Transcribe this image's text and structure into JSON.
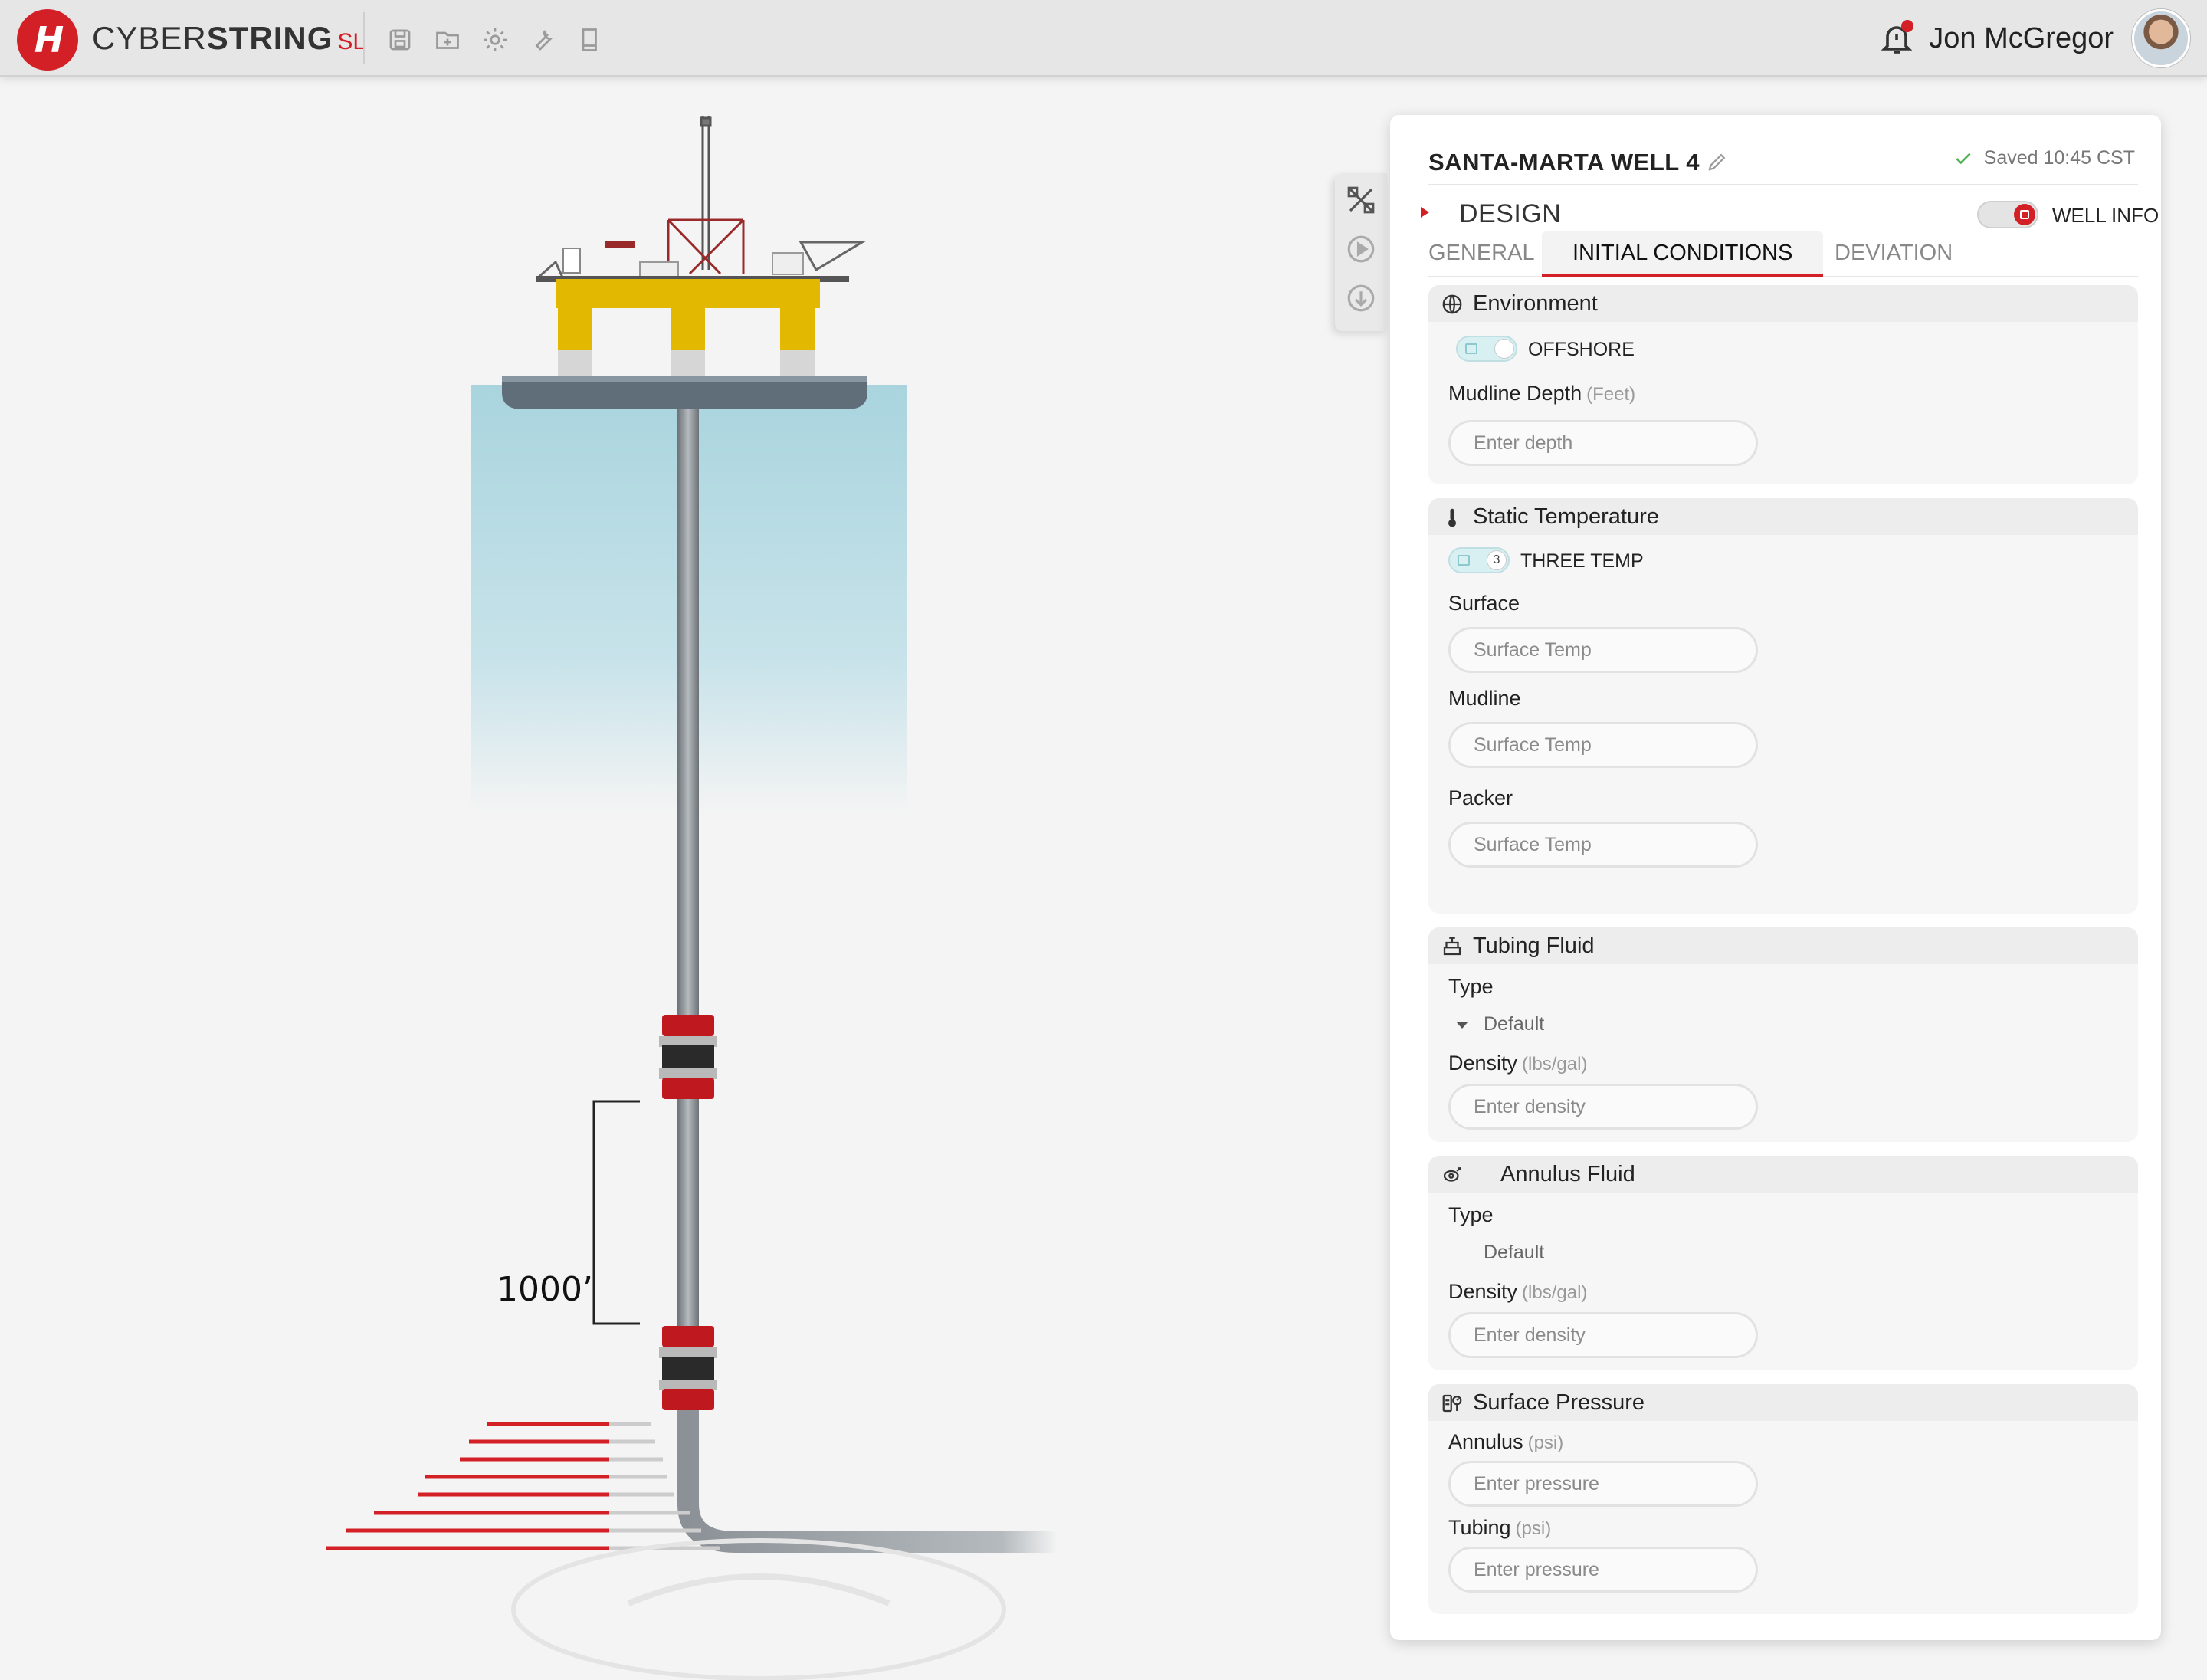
{
  "app": {
    "logo_letter": "H",
    "brand_light": "CYBER",
    "brand_bold": "STRING",
    "brand_suffix": "SL",
    "toolbar_icons": [
      "save-icon",
      "folder-add-icon",
      "settings-icon",
      "wrench-icon",
      "book-icon"
    ]
  },
  "user": {
    "name": "Jon McGregor",
    "has_notification": true
  },
  "illustration": {
    "depth_label": "1000’"
  },
  "rail": {
    "icons": [
      "design-tools-icon",
      "play-icon",
      "download-icon"
    ]
  },
  "panel": {
    "well_name": "SANTA-MARTA WELL 4",
    "saved_status": "Saved 10:45 CST",
    "section_title": "DESIGN",
    "well_info_label": "WELL INFO",
    "tabs": [
      {
        "label": "GENERAL",
        "active": false
      },
      {
        "label": "INITIAL CONDITIONS",
        "active": true
      },
      {
        "label": "DEVIATION",
        "active": false
      }
    ],
    "environment": {
      "title": "Environment",
      "toggle_label": "OFFSHORE",
      "mudline_label": "Mudline Depth",
      "mudline_unit": "(Feet)",
      "mudline_placeholder": "Enter depth"
    },
    "static_temperature": {
      "title": "Static Temperature",
      "toggle_knob": "3",
      "toggle_label": "THREE TEMP",
      "surface_label": "Surface",
      "surface_placeholder": "Surface Temp",
      "mudline_label": "Mudline",
      "mudline_placeholder": "Surface Temp",
      "packer_label": "Packer",
      "packer_placeholder": "Surface Temp"
    },
    "tubing_fluid": {
      "title": "Tubing Fluid",
      "type_label": "Type",
      "type_value": "Default",
      "density_label": "Density",
      "density_unit": "(lbs/gal)",
      "density_placeholder": "Enter density"
    },
    "annulus_fluid": {
      "title": "Annulus Fluid",
      "type_label": "Type",
      "type_value": "Default",
      "density_label": "Density",
      "density_unit": "(lbs/gal)",
      "density_placeholder": "Enter density"
    },
    "surface_pressure": {
      "title": "Surface Pressure",
      "annulus_label": "Annulus",
      "annulus_unit": "(psi)",
      "annulus_placeholder": "Enter pressure",
      "tubing_label": "Tubing",
      "tubing_unit": "(psi)",
      "tubing_placeholder": "Enter pressure"
    }
  },
  "colors": {
    "accent": "#d31f26",
    "platform_yellow": "#e3b800",
    "water": "#a9d4de",
    "pipe": "#8b9196",
    "saved_check": "#4caf50"
  }
}
